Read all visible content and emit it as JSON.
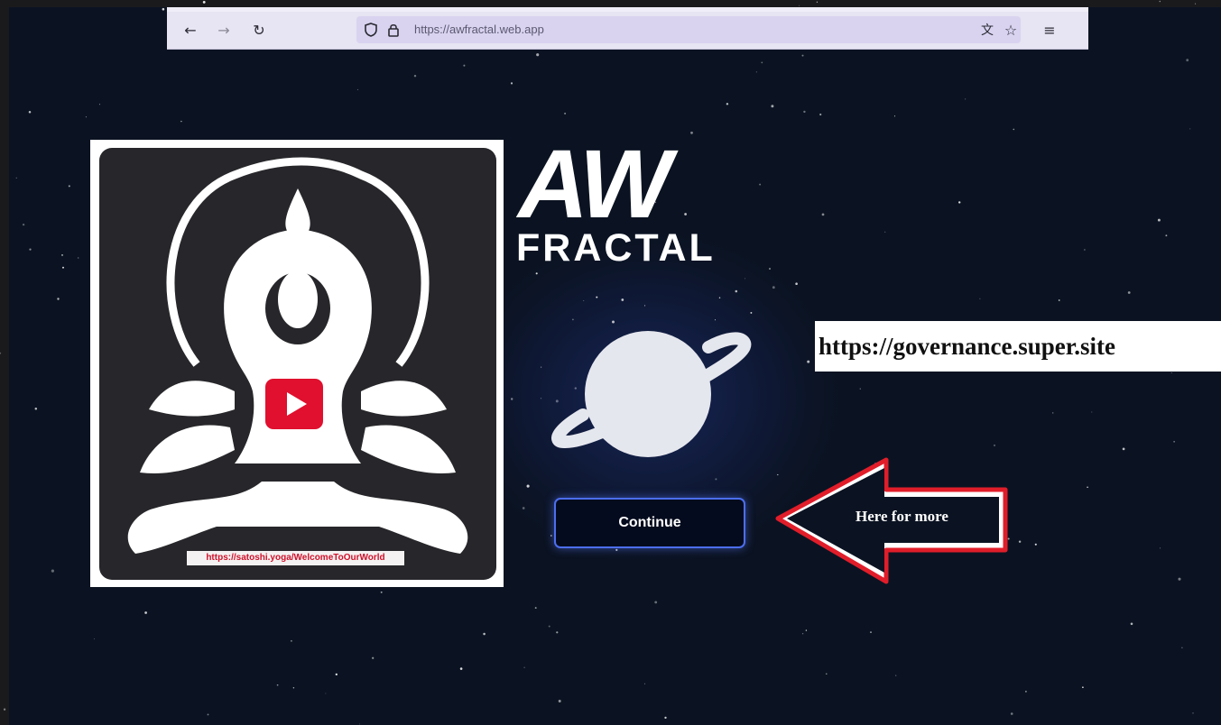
{
  "browser": {
    "url": "https://awfractal.web.app",
    "icons": [
      "back-arrow-icon",
      "forward-arrow-icon",
      "reload-icon",
      "shield-icon",
      "lock-icon",
      "translate-icon",
      "star-icon",
      "menu-icon"
    ]
  },
  "promo_image": {
    "caption": "https://satoshi.yoga/WelcomeToOurWorld"
  },
  "logo": {
    "line1": "AW",
    "line2": "FRACTAL"
  },
  "main": {
    "continue_label": "Continue"
  },
  "annotations": {
    "governance_link": "https://governance.super.site",
    "arrow_label": "Here for more"
  },
  "colors": {
    "background": "#0b1322",
    "button_border": "#4c6ef0",
    "youtube_red": "#e0102e",
    "arrow_red": "#e11d2a"
  }
}
